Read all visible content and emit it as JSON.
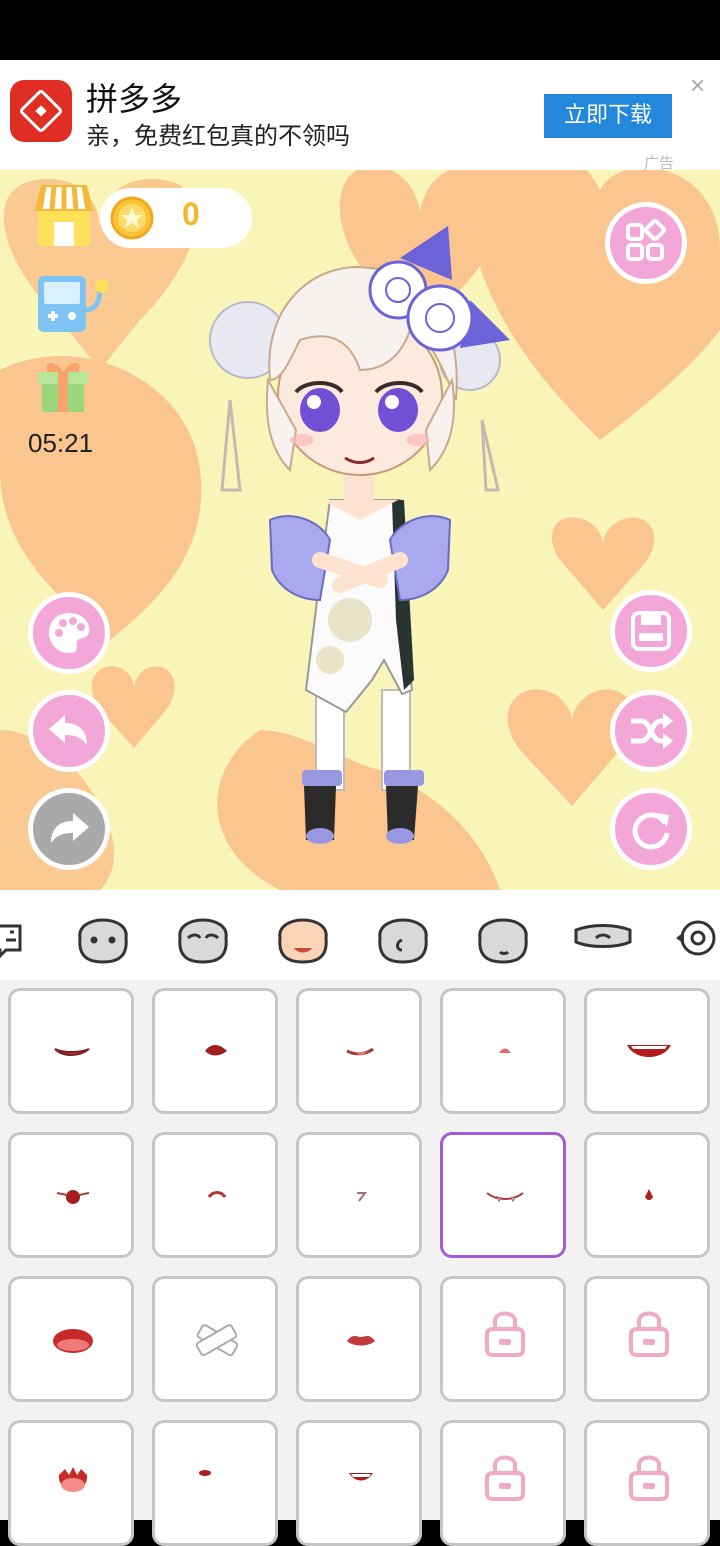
{
  "ad": {
    "app_name": "拼多多",
    "slogan": "亲，免费红包真的不领吗",
    "cta_label": "立即下载",
    "ad_mark": "广告",
    "close_glyph": "×"
  },
  "hud": {
    "coins": "0",
    "timer": "05:21"
  },
  "colors": {
    "stage_bg": "#f9f5b8",
    "heart": "#fbc58f",
    "button_pink": "#f3a7d9",
    "button_gray": "#a9a9a9",
    "selected_border": "#a35cd9",
    "ad_cta": "#2388d9"
  },
  "left_buttons": [
    "palette-icon",
    "undo-icon",
    "redo-icon"
  ],
  "right_buttons": [
    "grid-menu-icon",
    "save-icon",
    "shuffle-icon",
    "reset-icon"
  ],
  "categories": [
    "background-icon",
    "face-shape-icon",
    "eyes-icon",
    "mouth-icon",
    "ear-icon",
    "nose-icon",
    "mask-icon",
    "accessory-icon"
  ],
  "selected_category": "mouth-icon",
  "mouth_items": {
    "columns": 5,
    "rows_visible": 4,
    "selected_index": 8,
    "locked_indices": [
      13,
      14,
      18,
      19
    ]
  }
}
